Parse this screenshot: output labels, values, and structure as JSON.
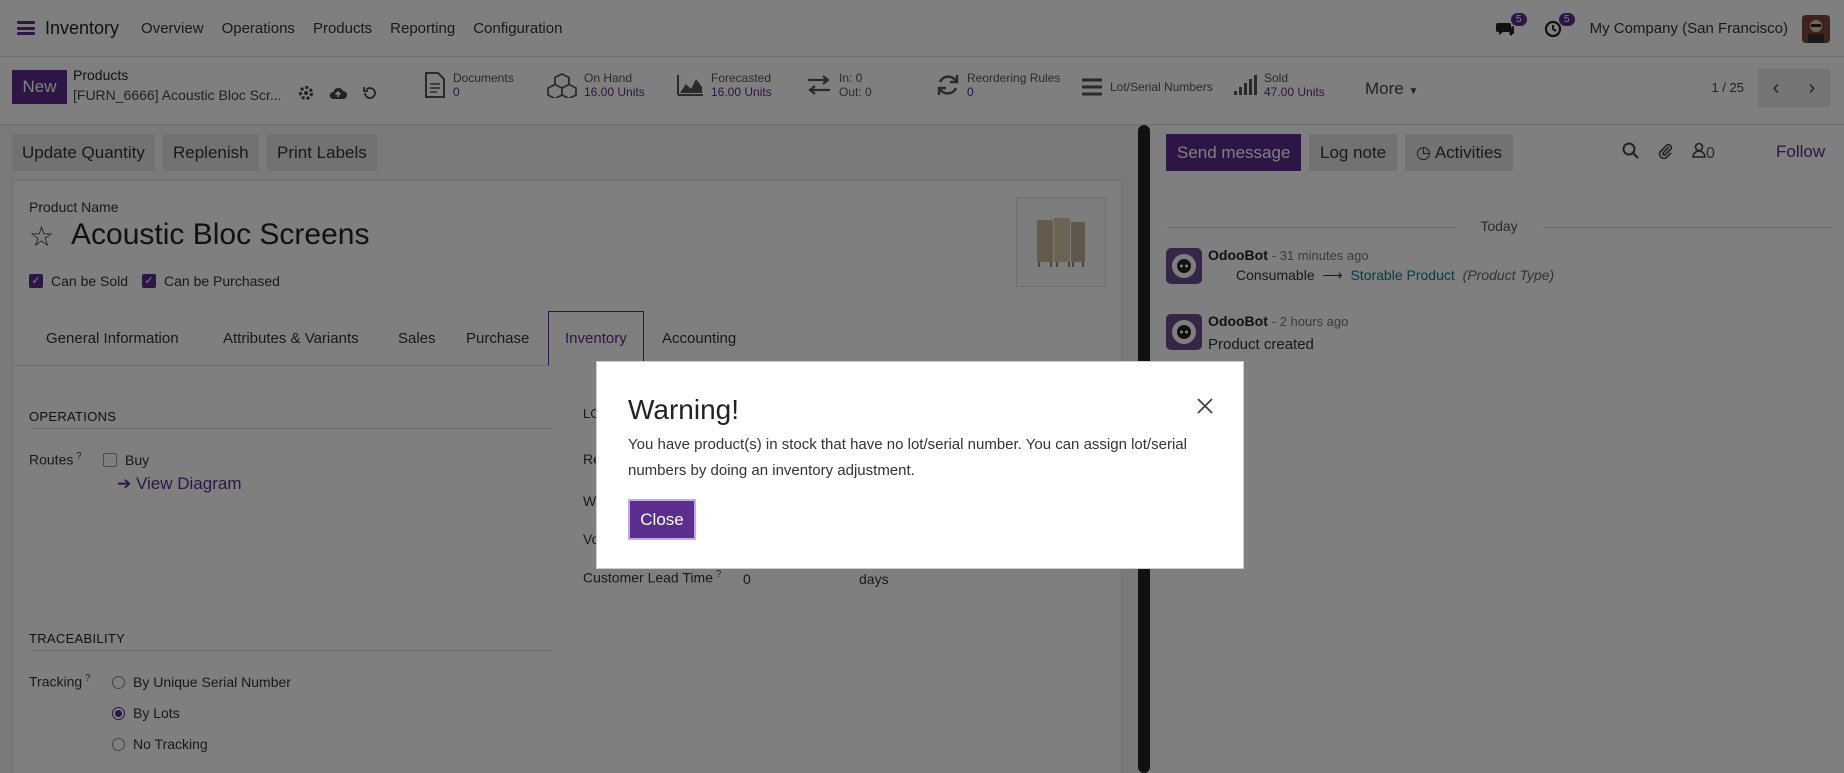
{
  "navbar": {
    "app_name": "Inventory",
    "menu": [
      "Overview",
      "Operations",
      "Products",
      "Reporting",
      "Configuration"
    ],
    "messages_count": "5",
    "activities_count": "5",
    "company": "My Company (San Francisco)"
  },
  "control_panel": {
    "new_label": "New",
    "breadcrumb_parent": "Products",
    "breadcrumb_record": "[FURN_6666] Acoustic Bloc Scr...",
    "stats": [
      {
        "label": "Documents",
        "value": "0"
      },
      {
        "label": "On Hand",
        "value": "16.00 Units"
      },
      {
        "label": "Forecasted",
        "value": "16.00 Units"
      },
      {
        "label": "In: 0",
        "value": "Out: 0"
      },
      {
        "label": "Reordering Rules",
        "value": "0"
      },
      {
        "label": "Lot/Serial Numbers",
        "value": ""
      },
      {
        "label": "Sold",
        "value": "47.00 Units"
      }
    ],
    "more_label": "More",
    "pager": "1 / 25"
  },
  "actions": {
    "update_quantity": "Update Quantity",
    "replenish": "Replenish",
    "print_labels": "Print Labels"
  },
  "form": {
    "product_name_label": "Product Name",
    "product_name": "Acoustic Bloc Screens",
    "can_be_sold": "Can be Sold",
    "can_be_purchased": "Can be Purchased",
    "tabs": [
      "General Information",
      "Attributes & Variants",
      "Sales",
      "Purchase",
      "Inventory",
      "Accounting"
    ],
    "operations_title": "OPERATIONS",
    "routes_label": "Routes",
    "route_buy": "Buy",
    "view_diagram": "View Diagram",
    "logistics_title_partial": "LO",
    "resp_partial": "Re",
    "weight_partial": "W",
    "volume_partial": "Vo",
    "customer_lead_time_label": "Customer Lead Time",
    "customer_lead_time_value": "0",
    "customer_lead_time_unit": "days",
    "traceability_title": "TRACEABILITY",
    "tracking_label": "Tracking",
    "tracking_options": [
      "By Unique Serial Number",
      "By Lots",
      "No Tracking"
    ]
  },
  "chatter": {
    "send_message": "Send message",
    "log_note": "Log note",
    "activities": "Activities",
    "followers_count": "0",
    "follow": "Follow",
    "today": "Today",
    "messages": [
      {
        "author": "OdooBot",
        "time": "- 31 minutes ago",
        "old_value": "Consumable",
        "new_value": "Storable Product",
        "field": "(Product Type)"
      },
      {
        "author": "OdooBot",
        "time": "- 2 hours ago",
        "body": "Product created"
      }
    ]
  },
  "dialog": {
    "title": "Warning!",
    "body": "You have product(s) in stock that have no lot/serial number. You can assign lot/serial numbers by doing an inventory adjustment.",
    "close_label": "Close"
  },
  "colors": {
    "brand": "#5b2d8c",
    "overlay": "rgba(0,0,0,0.5)"
  }
}
